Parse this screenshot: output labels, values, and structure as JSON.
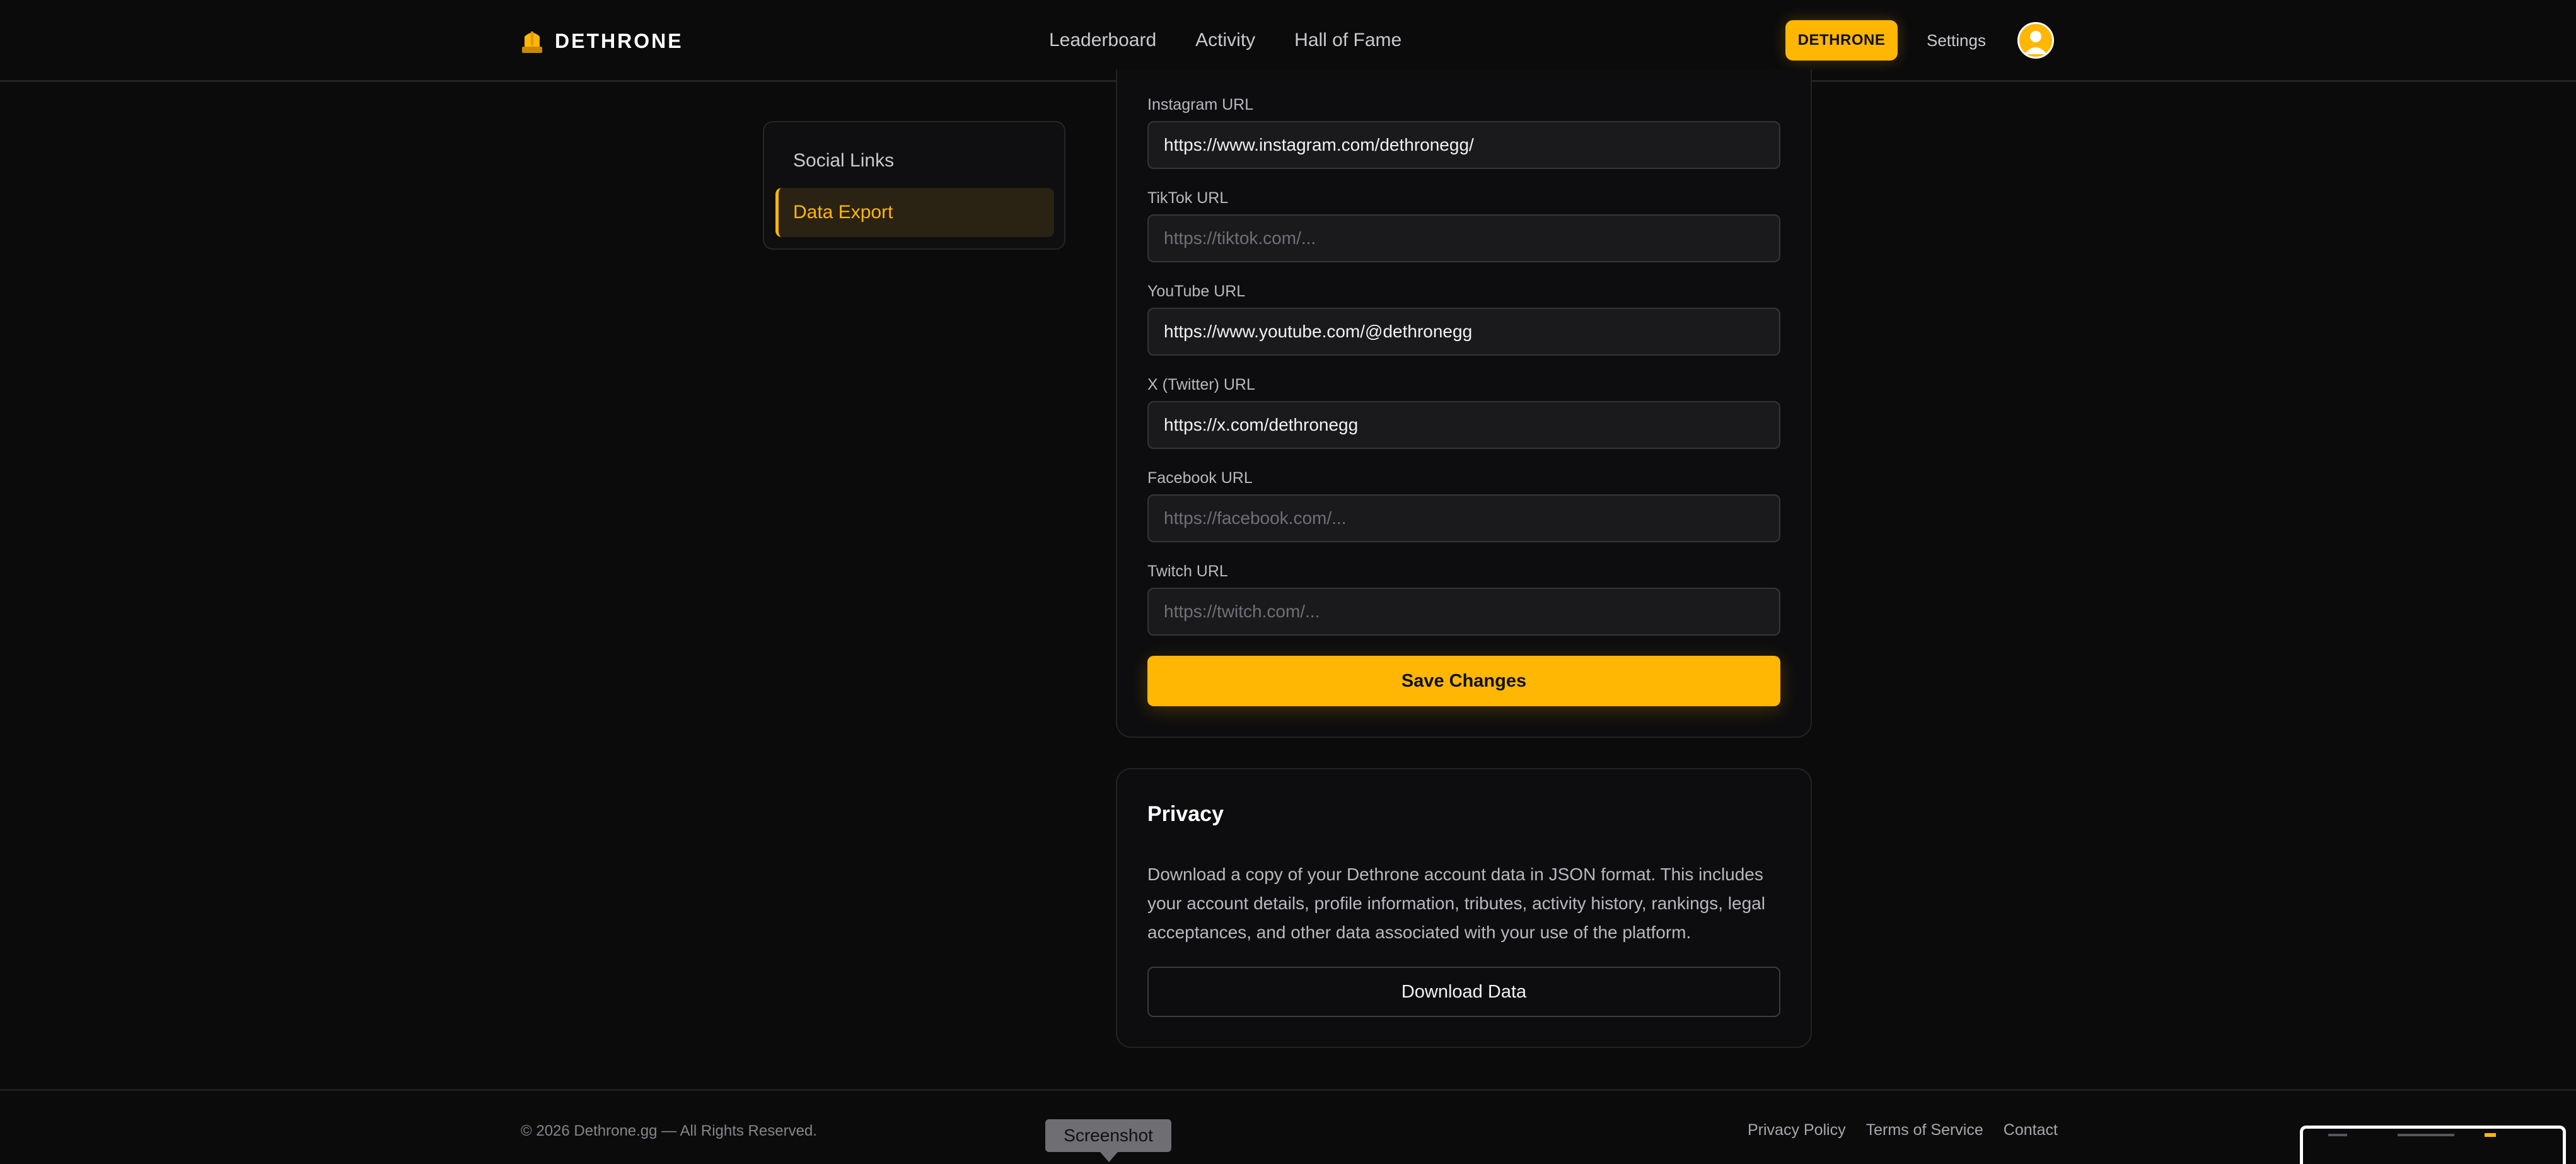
{
  "header": {
    "logo_text": "DETHRONE",
    "nav": [
      "Leaderboard",
      "Activity",
      "Hall of Fame"
    ],
    "cta_label": "DETHRONE",
    "settings_label": "Settings",
    "accent_color": "#ffb703"
  },
  "sidebar": {
    "items": [
      {
        "label": "Social Links",
        "active": false
      },
      {
        "label": "Data Export",
        "active": true
      }
    ]
  },
  "social": {
    "fields": [
      {
        "label": "Instagram URL",
        "value": "https://www.instagram.com/dethronegg/",
        "placeholder": ""
      },
      {
        "label": "TikTok URL",
        "value": "",
        "placeholder": "https://tiktok.com/..."
      },
      {
        "label": "YouTube URL",
        "value": "https://www.youtube.com/@dethronegg",
        "placeholder": ""
      },
      {
        "label": "X (Twitter) URL",
        "value": "https://x.com/dethronegg",
        "placeholder": ""
      },
      {
        "label": "Facebook URL",
        "value": "",
        "placeholder": "https://facebook.com/..."
      },
      {
        "label": "Twitch URL",
        "value": "",
        "placeholder": "https://twitch.com/..."
      }
    ],
    "save_label": "Save Changes"
  },
  "privacy": {
    "title": "Privacy",
    "description": "Download a copy of your Dethrone account data in JSON format. This includes your account details, profile information, tributes, activity history, rankings, legal acceptances, and other data associated with your use of the platform.",
    "download_label": "Download Data"
  },
  "footer": {
    "copyright": "© 2026 Dethrone.gg — All Rights Reserved.",
    "links": [
      "Privacy Policy",
      "Terms of Service",
      "Contact"
    ]
  },
  "tooltip": "Screenshot"
}
